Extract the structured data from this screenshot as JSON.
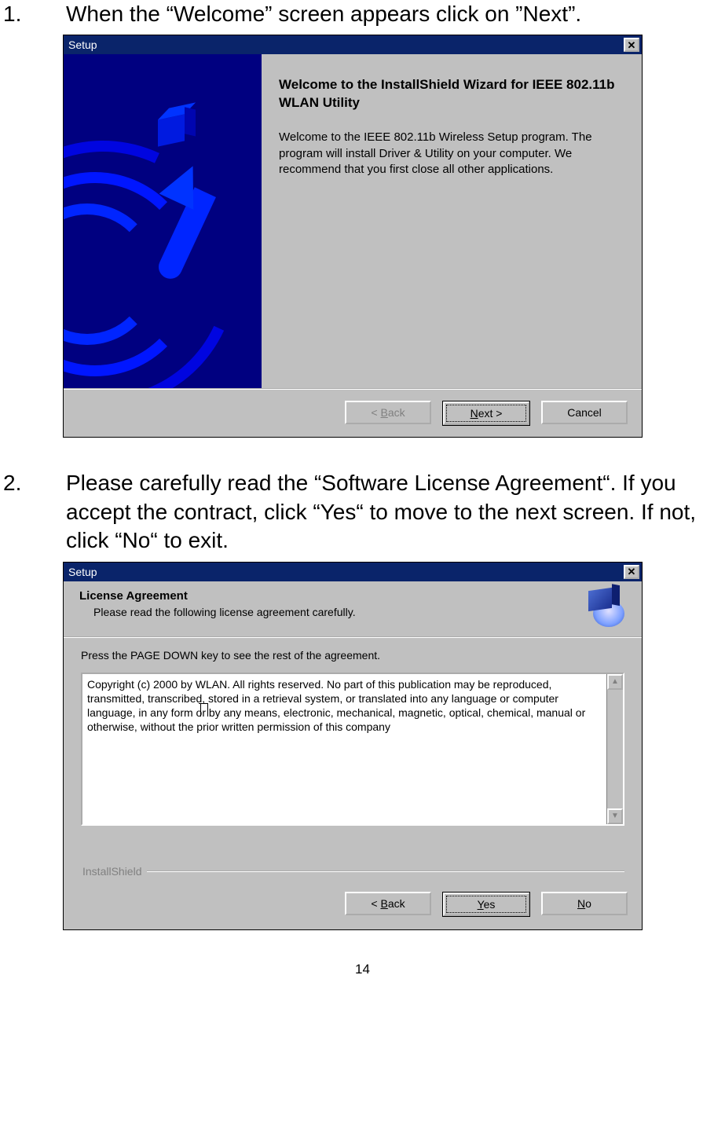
{
  "steps": {
    "one": {
      "num": "1.",
      "text": "When the “Welcome” screen appears click on ”Next”."
    },
    "two": {
      "num": "2.",
      "text": "Please carefully read the “Software License Agreement“. If you accept the contract, click  “Yes“ to move to the next screen. If not, click “No“ to exit."
    }
  },
  "win1": {
    "title": "Setup",
    "heading": "Welcome to the InstallShield Wizard for IEEE 802.11b WLAN Utility",
    "para": "Welcome to the IEEE 802.11b Wireless Setup program. The program will install Driver & Utility on your computer. We recommend that you first close all other applications.",
    "buttons": {
      "back_prefix": "< ",
      "back_u": "B",
      "back_suffix": "ack",
      "next_u": "N",
      "next_suffix": "ext >",
      "cancel": "Cancel"
    }
  },
  "win2": {
    "title": "Setup",
    "header_title": "License Agreement",
    "header_sub": "Please read the following license agreement carefully.",
    "hint": "Press the PAGE DOWN key to see the rest of the agreement.",
    "license_pre": "Copyright (c) 2000 by WLAN. All rights reserved. No part of this publication may be reproduced, transmitted, transcribed, stored in a retrieval system, or translated into any language or computer language, in any form o",
    "license_post": " by any means, electronic, mechanical, magnetic, optical, chemical, manual or otherwise, without the prior written permission of this company",
    "ishield": "InstallShield",
    "buttons": {
      "back_prefix": "< ",
      "back_u": "B",
      "back_suffix": "ack",
      "yes_u": "Y",
      "yes_suffix": "es",
      "no_u": "N",
      "no_suffix": "o"
    }
  },
  "page_number": "14"
}
